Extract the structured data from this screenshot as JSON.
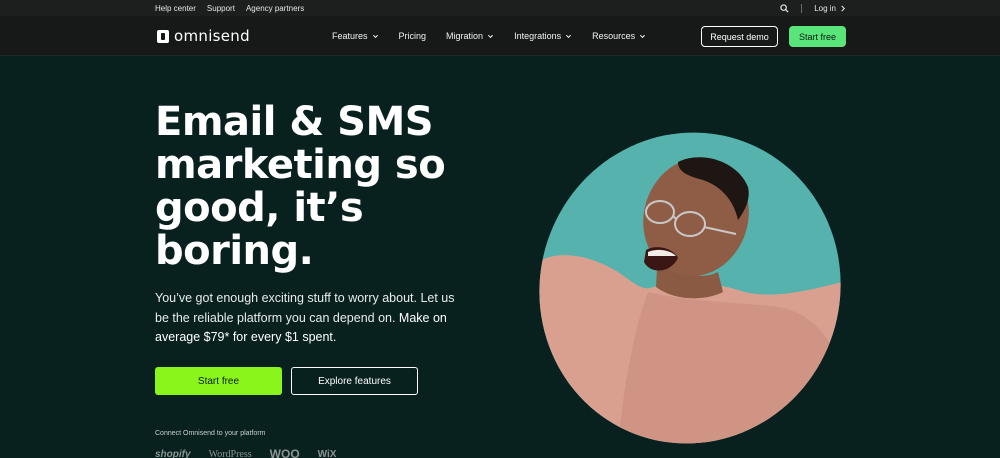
{
  "utility": {
    "links": [
      "Help center",
      "Support",
      "Agency partners"
    ],
    "login": "Log in"
  },
  "nav": {
    "logo_text": "omnisend",
    "items": [
      {
        "label": "Features",
        "dropdown": true
      },
      {
        "label": "Pricing",
        "dropdown": false
      },
      {
        "label": "Migration",
        "dropdown": true
      },
      {
        "label": "Integrations",
        "dropdown": true
      },
      {
        "label": "Resources",
        "dropdown": true
      }
    ],
    "request_demo": "Request demo",
    "start_free": "Start free"
  },
  "hero": {
    "title_lines": [
      "Email & SMS",
      "marketing so",
      "good, it’s",
      "boring."
    ],
    "subtitle_plain": "You’ve got enough exciting stuff to worry about. Let us be the reliable platform you can depend on. ",
    "subtitle_strong": "Make on average $79* for every $1 spent.",
    "cta_primary": "Start free",
    "cta_secondary": "Explore features",
    "platform_label": "Connect Omnisend to your platform",
    "platforms": [
      "shopify",
      "WordPress",
      "WOO",
      "WiX"
    ]
  },
  "colors": {
    "background": "#08211f",
    "nav_background": "#171918",
    "accent_green": "#8af51a",
    "nav_green": "#59e57a",
    "image_backdrop": "#5cb8b2"
  }
}
